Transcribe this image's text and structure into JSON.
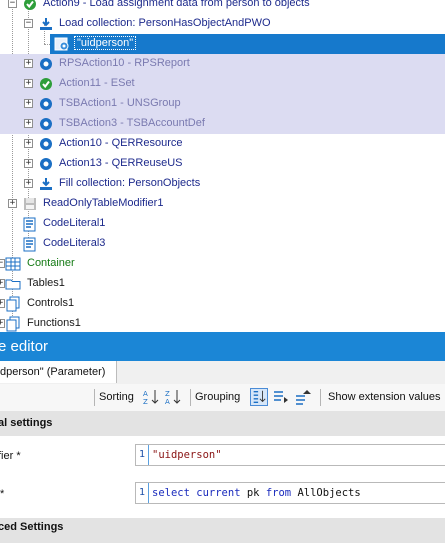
{
  "tree": {
    "rows": [
      {
        "label": "Action9 - Load assignment data from person to objects",
        "style": "blue",
        "icon": "check-green-icon"
      },
      {
        "label": "Load collection: PersonHasObjectAndPWO",
        "style": "blue",
        "icon": "load-collection-icon"
      },
      {
        "label": "\"uidperson\"",
        "style": "white",
        "icon": "parameter-icon"
      },
      {
        "label": "RPSAction10 - RPSReport",
        "style": "gray",
        "icon": "gear-icon"
      },
      {
        "label": "Action11 - ESet",
        "style": "gray",
        "icon": "check-green-icon"
      },
      {
        "label": "TSBAction1 - UNSGroup",
        "style": "gray",
        "icon": "gear-icon"
      },
      {
        "label": "TSBAction3 - TSBAccountDef",
        "style": "gray",
        "icon": "gear-icon"
      },
      {
        "label": "Action10 - QERResource",
        "style": "blue",
        "icon": "gear-icon"
      },
      {
        "label": "Action13 - QERReuseUS",
        "style": "blue",
        "icon": "gear-icon"
      },
      {
        "label": "Fill collection: PersonObjects",
        "style": "blue",
        "icon": "load-collection-icon"
      },
      {
        "label": "ReadOnlyTableModifier1",
        "style": "blue",
        "icon": "disk-icon"
      },
      {
        "label": "CodeLiteral1",
        "style": "blue",
        "icon": "code-literal-icon"
      },
      {
        "label": "CodeLiteral3",
        "style": "blue",
        "icon": "code-literal-icon"
      },
      {
        "label": "Container",
        "style": "green",
        "icon": "container-grid-icon"
      },
      {
        "label": "Tables1",
        "style": "dark",
        "icon": "folder-icon"
      },
      {
        "label": "Controls1",
        "style": "dark",
        "icon": "pages-icon"
      },
      {
        "label": "Functions1",
        "style": "dark",
        "icon": "pages-icon"
      }
    ]
  },
  "editor": {
    "title": "e editor",
    "tab_label": "dperson\" (Parameter)",
    "toolbar": {
      "sorting_label": "Sorting",
      "grouping_label": "Grouping",
      "show_ext_label": "Show extension values"
    },
    "section_general": "al settings",
    "section_advanced": "ced Settings",
    "fields": [
      {
        "label": "fier *",
        "line_no": "1",
        "code": "\"uidperson\""
      },
      {
        "label": "*",
        "line_no": "1",
        "code_kw1": "select",
        "code_kw2": "current",
        "code_mid": "pk",
        "code_kw3": "from",
        "code_end": "AllObjects"
      }
    ]
  },
  "colors": {
    "accent": "#1b86d6",
    "selection": "#1679cc",
    "band": "#dcdcf2"
  }
}
